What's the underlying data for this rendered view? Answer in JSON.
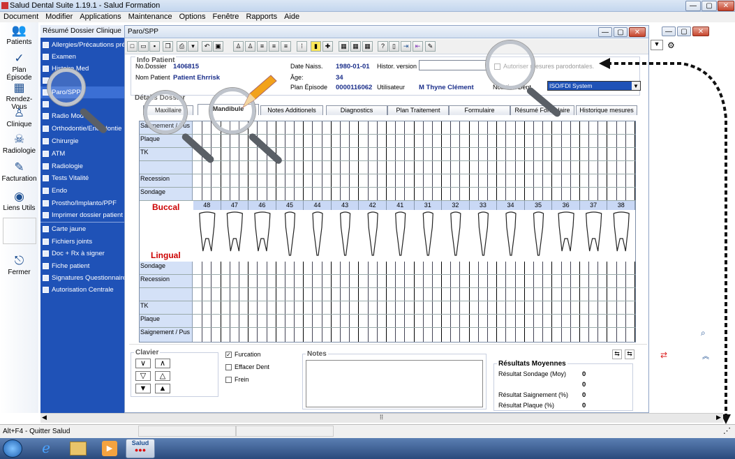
{
  "app": {
    "title": "Salud Dental Suite 1.19.1 - Salud Formation"
  },
  "menubar": [
    "Document",
    "Modifier",
    "Applications",
    "Maintenance",
    "Options",
    "Fenêtre",
    "Rapports",
    "Aide"
  ],
  "leftnav": {
    "items": [
      "Patients",
      "Plan Épisode",
      "Rendez-Vous",
      "Clinique",
      "Radiologie",
      "Facturation",
      "Liens Utils",
      "Fermer"
    ]
  },
  "sidenav": {
    "header": "Résumé Dossier Clinique",
    "items": [
      "Allergies/Précautions préop.",
      "Examen",
      "Histoire Med",
      "Paro/SPP",
      "Radio Mod",
      "Orthodontie/Endodontie",
      "Chirurgie",
      "ATM",
      "Radiologie",
      "Tests Vitalité",
      "Endo",
      "Prostho/Implanto/PPF",
      "Imprimer dossier patient"
    ],
    "items2": [
      "Carte jaune",
      "Fichiers joints",
      "Doc + Rx à signer",
      "Fiche patient",
      "Signatures Questionnaire",
      "Autorisation Centrale"
    ]
  },
  "dialog": {
    "title": "Paro/SPP",
    "info_title": "Info Patient",
    "no_dossier_label": "No.Dossier",
    "no_dossier": "1406815",
    "nom_label": "Nom Patient",
    "nom": "Patient Ehrrisk",
    "naiss_label": "Date Naiss.",
    "naiss": "1980-01-01",
    "age_label": "Âge:",
    "age": "34",
    "plan_label": "Plan Épisode",
    "plan": "0000116062",
    "histor_label": "Histor. version",
    "histor_value": "",
    "autoriser_label": "Autoriser mesures parodontales.",
    "utilisateur_label": "Utilisateur",
    "utilisateur": "M Thyne Clément",
    "notation_label": "Notation Dent",
    "notation": "ISO/FDI System",
    "details_title": "Détails Dossier",
    "tabs": [
      "Maxillaire",
      "Mandibule",
      "Notes Additionels",
      "Diagnostics",
      "Plan Traitement",
      "Formulaire",
      "Résumé Formulaire",
      "Historique mesures"
    ],
    "rows_top": [
      "Saignement / Pus",
      "Plaque",
      "TK",
      "",
      "Recession",
      "Sondage"
    ],
    "buccal": "Buccal",
    "lingual": "Lingual",
    "teeth": [
      "48",
      "47",
      "46",
      "45",
      "44",
      "43",
      "42",
      "41",
      "31",
      "32",
      "33",
      "34",
      "35",
      "36",
      "37",
      "38"
    ],
    "rows_bottom": [
      "Sondage",
      "Recession",
      "",
      "TK",
      "Plaque",
      "Saignement / Pus"
    ],
    "clavier_title": "Clavier",
    "furcation": "Furcation",
    "effacer": "Effacer Dent",
    "frein": "Frein",
    "notes_title": "Notes",
    "results_title": "Résultats Moyennes",
    "res_sondage": "Résultat Sondage (Moy)",
    "res_sondage_val": "0",
    "res_blank_val": "0",
    "res_saignement": "Résultat Saignement (%)",
    "res_saignement_val": "0",
    "res_plaque": "Résultat Plaque (%)",
    "res_plaque_val": "0"
  },
  "statusbar": {
    "hint": "Alt+F4 - Quitter Salud"
  },
  "taskbar": {
    "app_label": "Salud"
  }
}
